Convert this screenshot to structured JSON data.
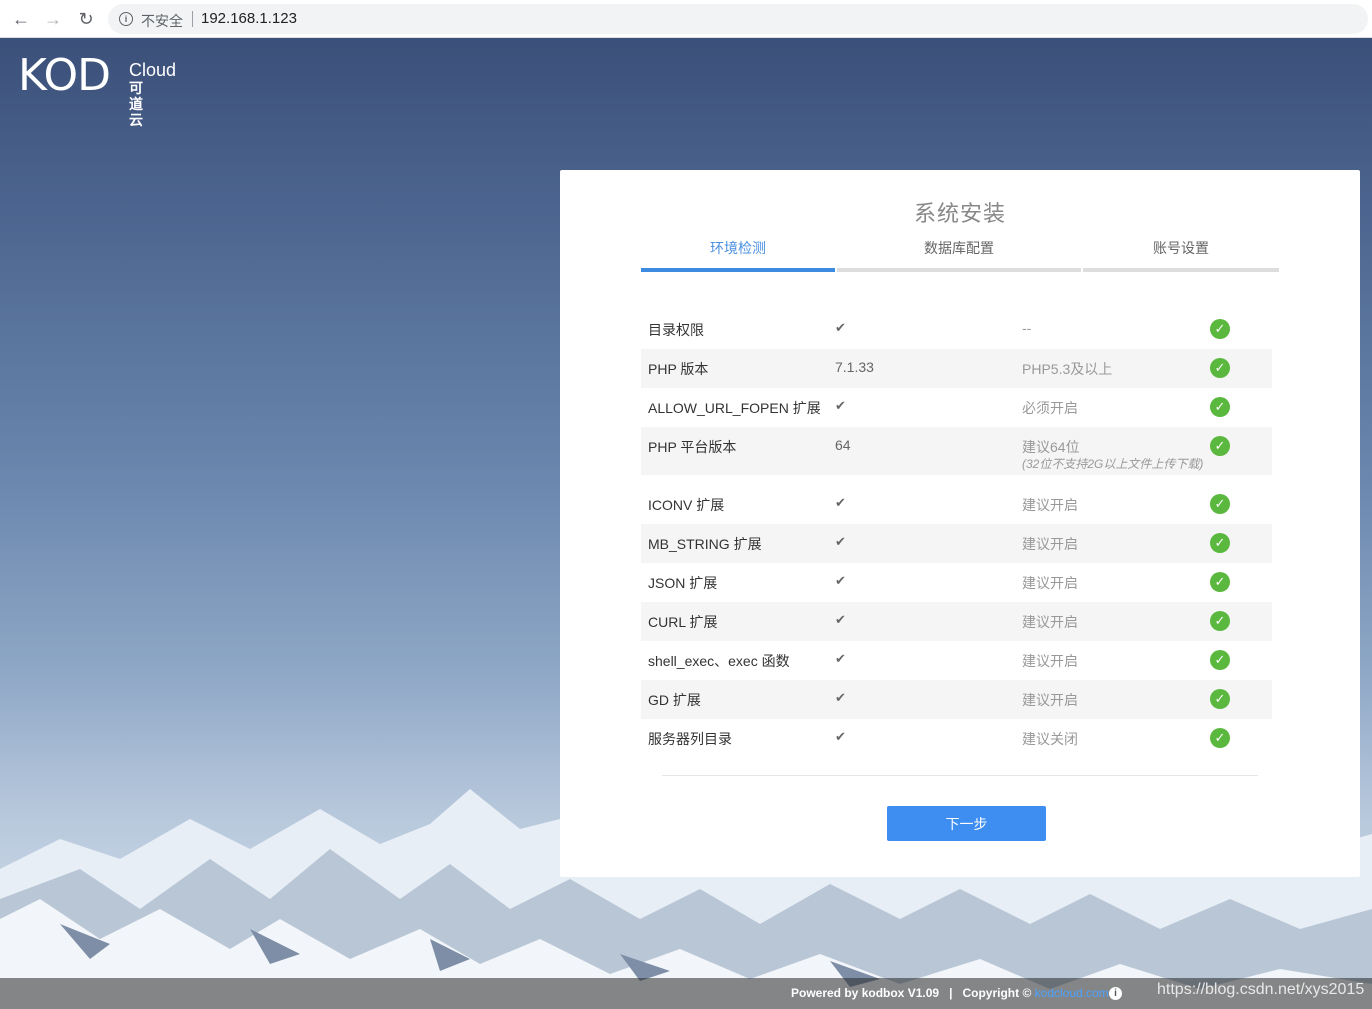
{
  "browser": {
    "security_label": "不安全",
    "url": "192.168.1.123"
  },
  "logo": {
    "main": "KOD",
    "cloud": "Cloud",
    "cn": "可道云"
  },
  "panel": {
    "title": "系统安装",
    "tabs": [
      {
        "label": "环境检测",
        "active": true
      },
      {
        "label": "数据库配置",
        "active": false
      },
      {
        "label": "账号设置",
        "active": false
      }
    ],
    "checks": [
      {
        "name": "目录权限",
        "value": "✔",
        "requirement": "--",
        "ok": true
      },
      {
        "name": "PHP 版本",
        "value": "7.1.33",
        "requirement": "PHP5.3及以上",
        "ok": true
      },
      {
        "name": "ALLOW_URL_FOPEN 扩展",
        "value": "✔",
        "requirement": "必须开启",
        "ok": true
      },
      {
        "name": "PHP 平台版本",
        "value": "64",
        "requirement": "建议64位",
        "note": "(32位不支持2G以上文件上传下载)",
        "ok": true
      },
      {
        "name": "ICONV 扩展",
        "value": "✔",
        "requirement": "建议开启",
        "ok": true
      },
      {
        "name": "MB_STRING 扩展",
        "value": "✔",
        "requirement": "建议开启",
        "ok": true
      },
      {
        "name": "JSON 扩展",
        "value": "✔",
        "requirement": "建议开启",
        "ok": true
      },
      {
        "name": "CURL 扩展",
        "value": "✔",
        "requirement": "建议开启",
        "ok": true
      },
      {
        "name": "shell_exec、exec 函数",
        "value": "✔",
        "requirement": "建议开启",
        "ok": true
      },
      {
        "name": "GD 扩展",
        "value": "✔",
        "requirement": "建议开启",
        "ok": true
      },
      {
        "name": "服务器列目录",
        "value": "✔",
        "requirement": "建议关闭",
        "ok": true
      }
    ],
    "next_label": "下一步"
  },
  "footer": {
    "powered": "Powered by kodbox V1.09",
    "sep": "|",
    "copyright": "Copyright ©",
    "link": "kodcloud.com",
    "watermark": "https://blog.csdn.net/xys2015"
  },
  "colors": {
    "accent": "#3d8ef0",
    "ok": "#5bb83f"
  }
}
